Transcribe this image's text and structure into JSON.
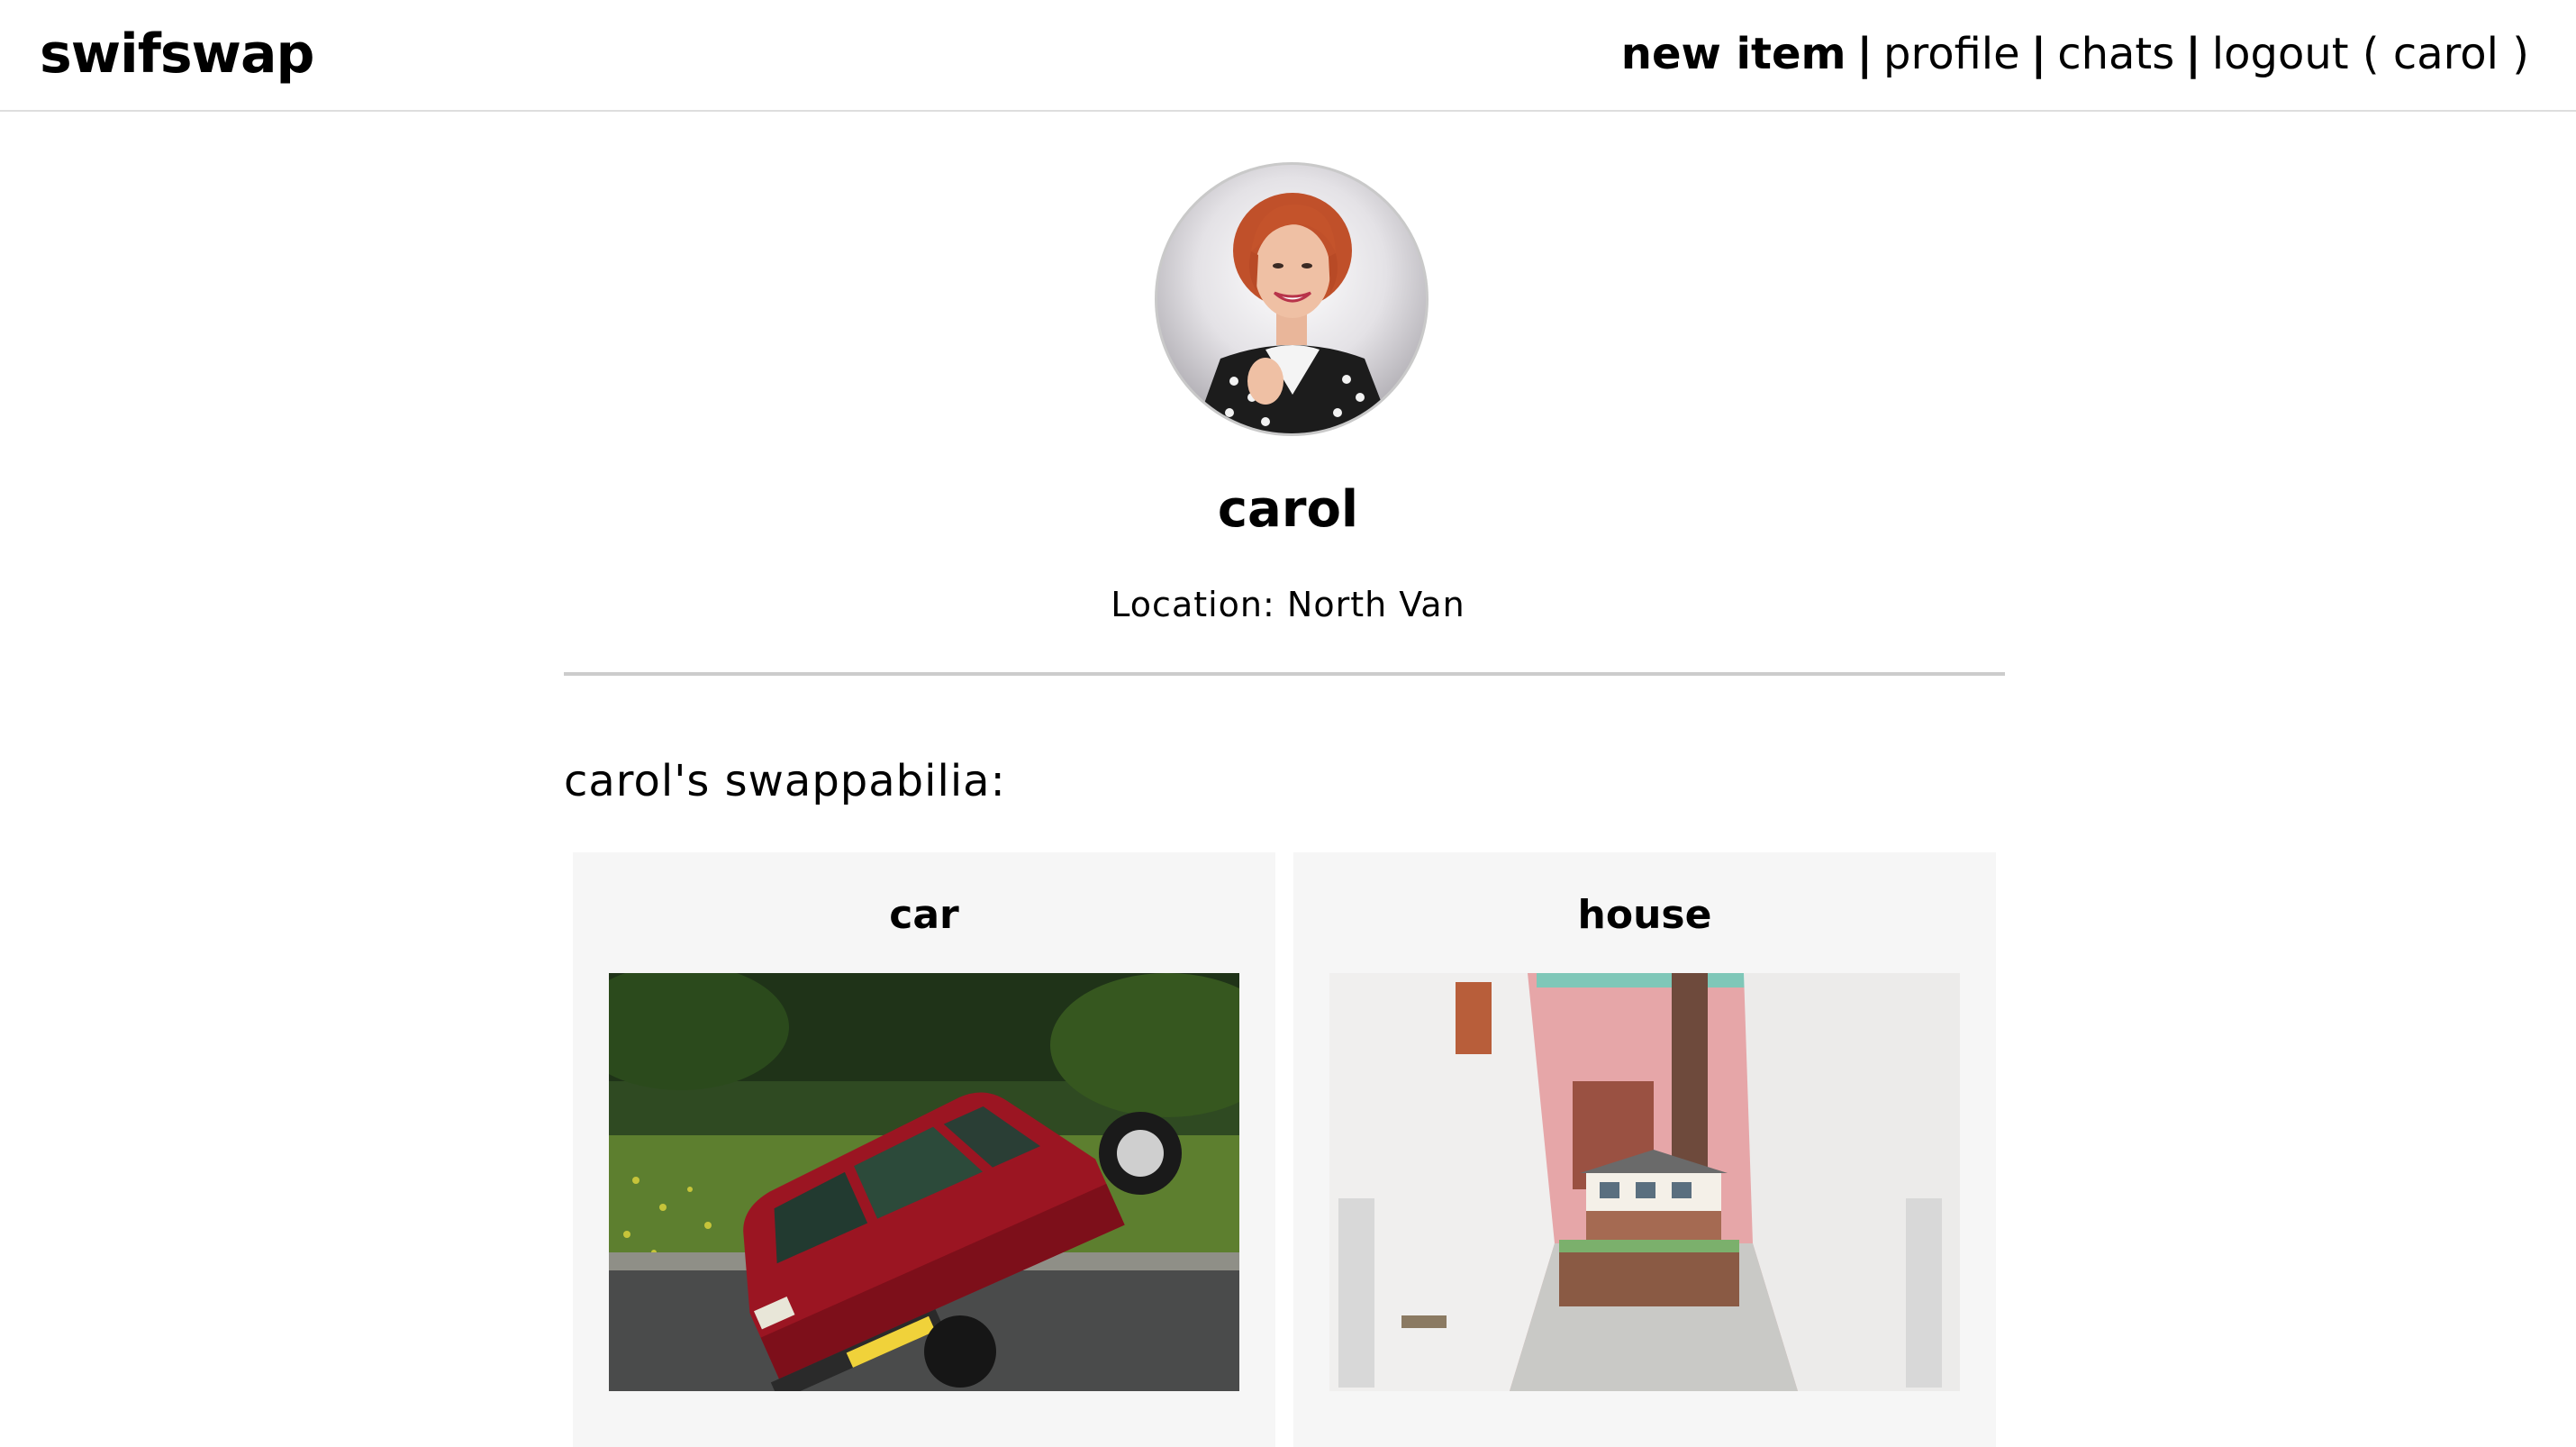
{
  "header": {
    "brand": "swifswap",
    "nav": {
      "new_item": "new item",
      "separator": "|",
      "profile": "profile",
      "chats": "chats",
      "logout": "logout ( carol )"
    }
  },
  "profile": {
    "username": "carol",
    "location": "Location: North Van"
  },
  "items_section": {
    "heading": "carol's swappabilia:",
    "items": [
      {
        "title": "car"
      },
      {
        "title": "house"
      }
    ]
  },
  "colors": {
    "card_background": "#f6f6f6",
    "divider": "#cccccc",
    "header_border": "#dedede",
    "car_red": "#9b1522"
  }
}
